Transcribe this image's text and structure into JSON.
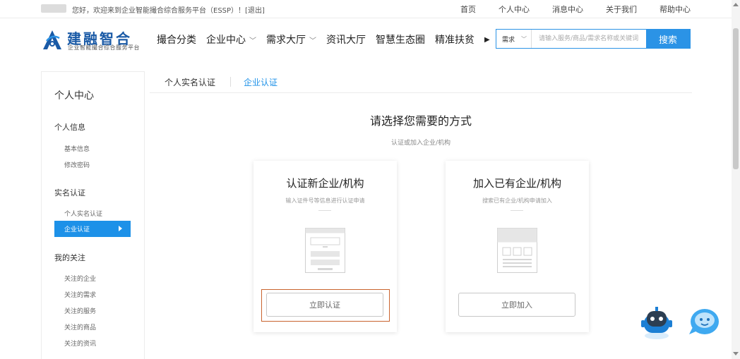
{
  "topbar": {
    "greeting": "您好，欢迎来到企业智能撮合综合服务平台（ESSP）！[退出]",
    "links": [
      "首页",
      "个人中心",
      "消息中心",
      "关于我们",
      "帮助中心"
    ]
  },
  "header": {
    "logo_title": "建融智合",
    "logo_subtitle": "企业智能撮合综合服务平台",
    "nav": [
      "撮合分类",
      "企业中心",
      "需求大厅",
      "资讯大厅",
      "智慧生态圈",
      "精准扶贫"
    ],
    "search_type": "需求",
    "search_placeholder": "请输入服务/商品/需求名称或关键词",
    "search_button": "搜索"
  },
  "sidebar": {
    "title": "个人中心",
    "sections": [
      {
        "label": "个人信息",
        "items": [
          "基本信息",
          "修改密码"
        ]
      },
      {
        "label": "实名认证",
        "items": [
          "个人实名认证",
          "企业认证"
        ]
      },
      {
        "label": "我的关注",
        "items": [
          "关注的企业",
          "关注的需求",
          "关注的服务",
          "关注的商品",
          "关注的资讯"
        ]
      }
    ],
    "active_item": "企业认证"
  },
  "tabs": {
    "items": [
      "个人实名认证",
      "企业认证"
    ],
    "active": "企业认证"
  },
  "main": {
    "title": "请选择您需要的方式",
    "subtitle": "认证或加入企业/机构",
    "cards": [
      {
        "title": "认证新企业/机构",
        "desc": "输入证件号等信息进行认证申请",
        "button": "立即认证"
      },
      {
        "title": "加入已有企业/机构",
        "desc": "搜索已有企业/机构申请加入",
        "button": "立即加入"
      }
    ]
  },
  "colors": {
    "brand": "#1a5aa6",
    "accent": "#2b93e6",
    "active": "#1d91e8",
    "highlight_border": "#c9632e"
  },
  "icons": [
    "logo-mark-icon",
    "chevron-down-icon",
    "triangle-right-icon",
    "form-illustration-icon",
    "grid-illustration-icon",
    "robot-assistant-icon",
    "chat-bubble-icon"
  ]
}
